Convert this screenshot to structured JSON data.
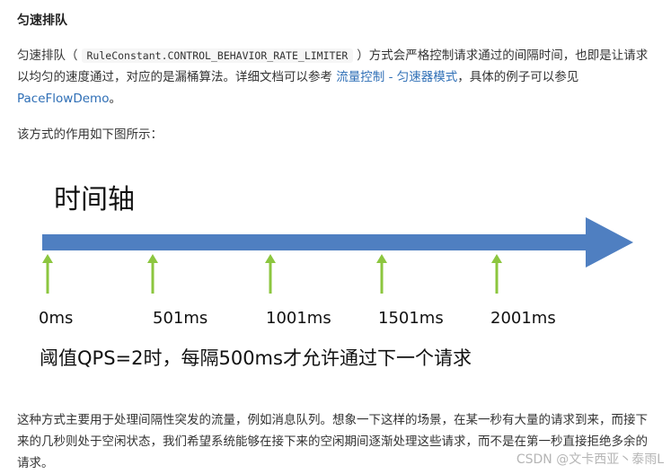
{
  "heading": "匀速排队",
  "paragraph1": {
    "before_code": "匀速排队（",
    "code": "RuleConstant.CONTROL_BEHAVIOR_RATE_LIMITER",
    "after_code": "）方式会严格控制请求通过的间隔时间，也即是让请求以均匀的速度通过，对应的是漏桶算法。详细文档可以参考 ",
    "link1": "流量控制 - 匀速器模式",
    "middle": "，具体的例子可以参见 ",
    "link2": "PaceFlowDemo",
    "end": "。"
  },
  "paragraph2": "该方式的作用如下图所示：",
  "diagram": {
    "title": "时间轴",
    "ticks": [
      "0ms",
      "501ms",
      "1001ms",
      "1501ms",
      "2001ms"
    ],
    "caption": "阈值QPS=2时，每隔500ms才允许通过下一个请求",
    "colors": {
      "axis": "#4f7fc1",
      "tick": "#8cc63f"
    }
  },
  "paragraph3": "这种方式主要用于处理间隔性突发的流量，例如消息队列。想象一下这样的场景，在某一秒有大量的请求到来，而接下来的几秒则处于空闲状态，我们希望系统能够在接下来的空闲期间逐渐处理这些请求，而不是在第一秒直接拒绝多余的请求。",
  "watermark": "CSDN @文卡西亚丶泰雨L"
}
